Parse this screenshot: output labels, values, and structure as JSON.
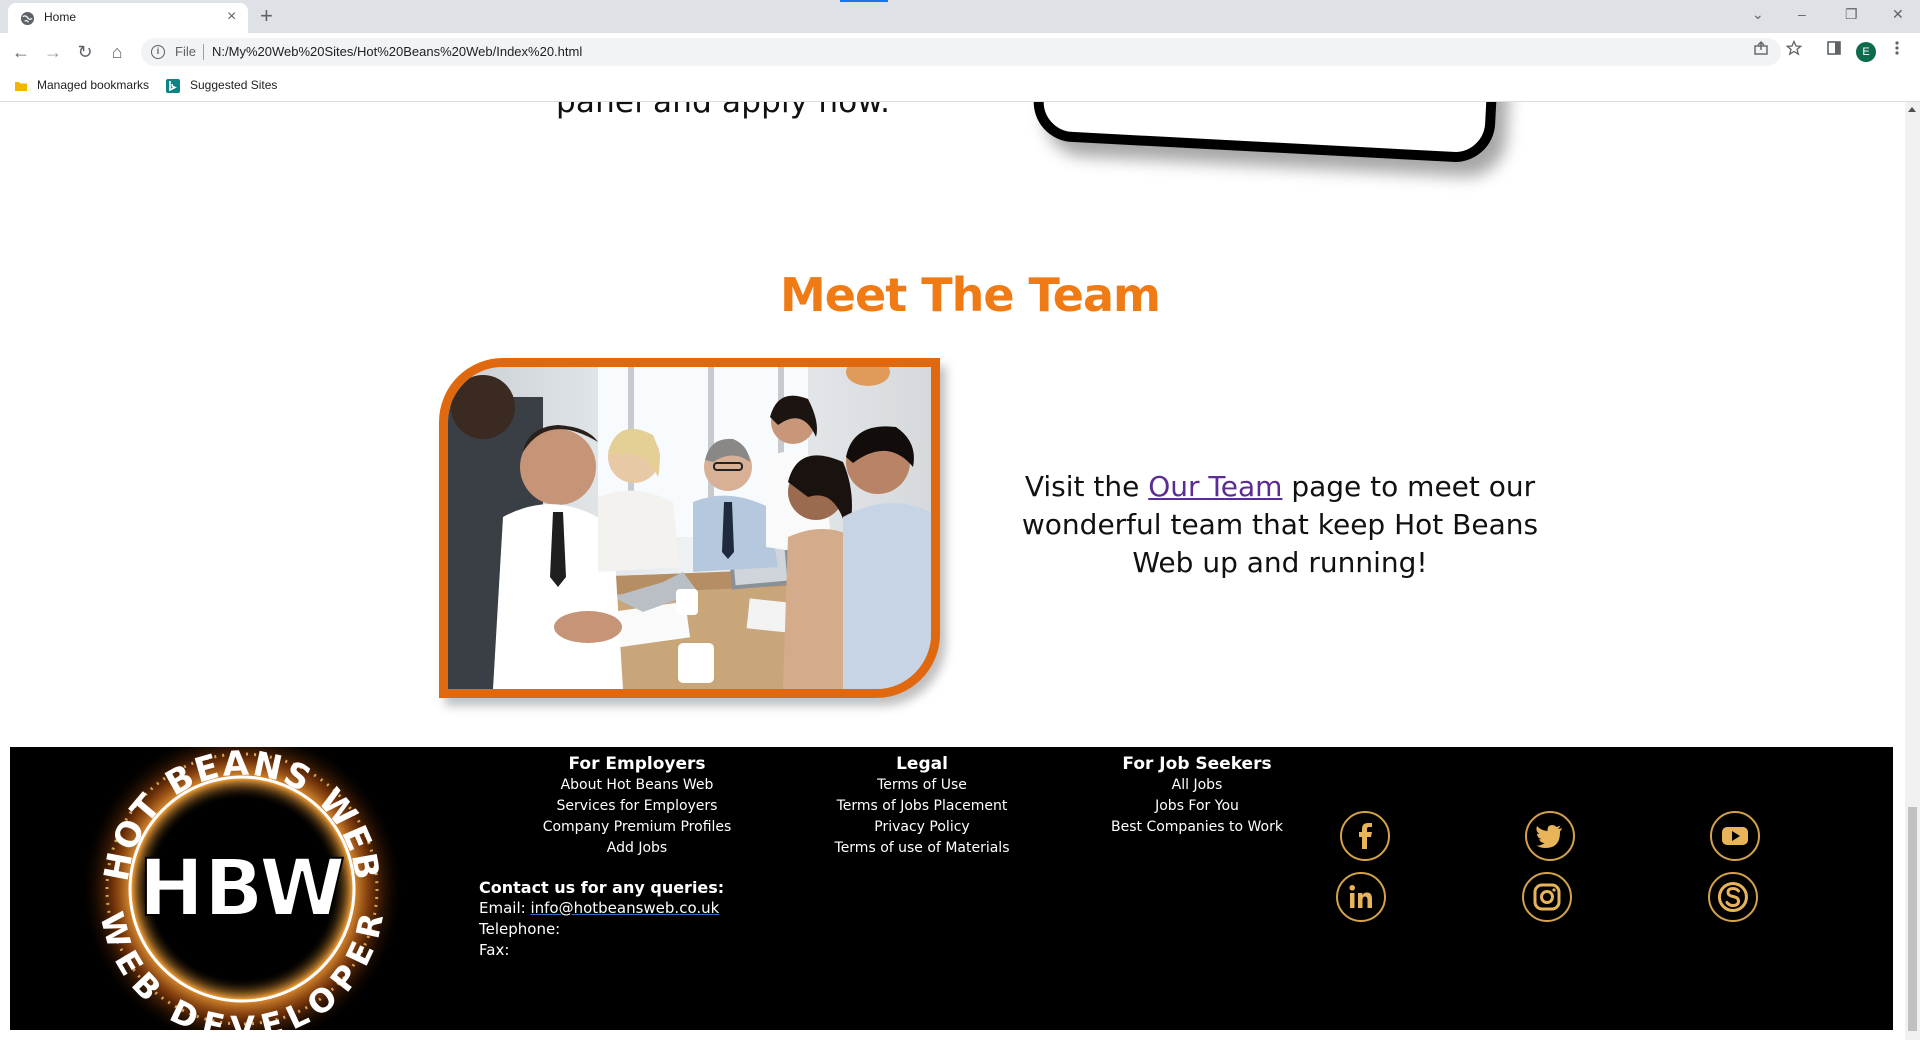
{
  "browser": {
    "tab_title": "Home",
    "tab_close": "×",
    "new_tab": "+",
    "controls": {
      "tab_search": "⌄",
      "minimize": "–",
      "restore": "❐",
      "close": "✕"
    },
    "nav": {
      "back": "←",
      "forward": "→",
      "reload": "↻",
      "home": "⌂"
    },
    "scheme_label": "File",
    "url": "N:/My%20Web%20Sites/Hot%20Beans%20Web/Index%20.html",
    "profile_initial": "E",
    "bookmarks": [
      "Managed bookmarks",
      "Suggested Sites"
    ]
  },
  "page": {
    "top_text_fragment": "panel and apply now.",
    "section_title": "Meet The Team",
    "team_text": {
      "before": "Visit the ",
      "link": "Our Team",
      "after": " page to meet our wonderful team that keep Hot Beans Web up and running!"
    }
  },
  "footer": {
    "logo": {
      "ring_text_top": "HOT BEANS WEB",
      "center": "HBW",
      "ring_text_bottom": "WEB DEVELOPER"
    },
    "columns": [
      {
        "heading": "For Employers",
        "links": [
          "About Hot Beans Web",
          "Services for Employers",
          "Company Premium Profiles",
          "Add Jobs"
        ]
      },
      {
        "heading": "Legal",
        "links": [
          "Terms of Use",
          "Terms of Jobs Placement",
          "Privacy Policy",
          "Terms of use of Materials"
        ]
      },
      {
        "heading": "For Job Seekers",
        "links": [
          "All Jobs",
          "Jobs For You",
          "Best Companies to Work"
        ]
      }
    ],
    "contact": {
      "heading": "Contact us for any queries:",
      "email_label": "Email: ",
      "email": "info@hotbeansweb.co.uk",
      "telephone_label": "Telephone:",
      "fax_label": "Fax:"
    },
    "social": [
      "facebook-icon",
      "twitter-icon",
      "youtube-icon",
      "linkedin-icon",
      "instagram-icon",
      "skype-icon"
    ]
  },
  "colors": {
    "accent_orange": "#f07a14",
    "frame_orange": "#e0690f",
    "link_purple": "#5b2c91",
    "social_gold": "#d4a24a",
    "footer_bg": "#000000"
  }
}
